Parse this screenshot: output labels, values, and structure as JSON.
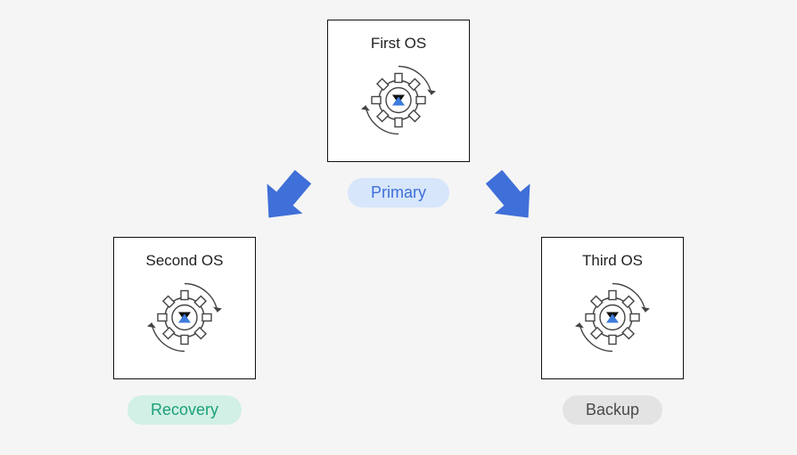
{
  "nodes": {
    "first": {
      "title": "First OS",
      "badge": "Primary"
    },
    "second": {
      "title": "Second OS",
      "badge": "Recovery"
    },
    "third": {
      "title": "Third OS",
      "badge": "Backup"
    }
  }
}
